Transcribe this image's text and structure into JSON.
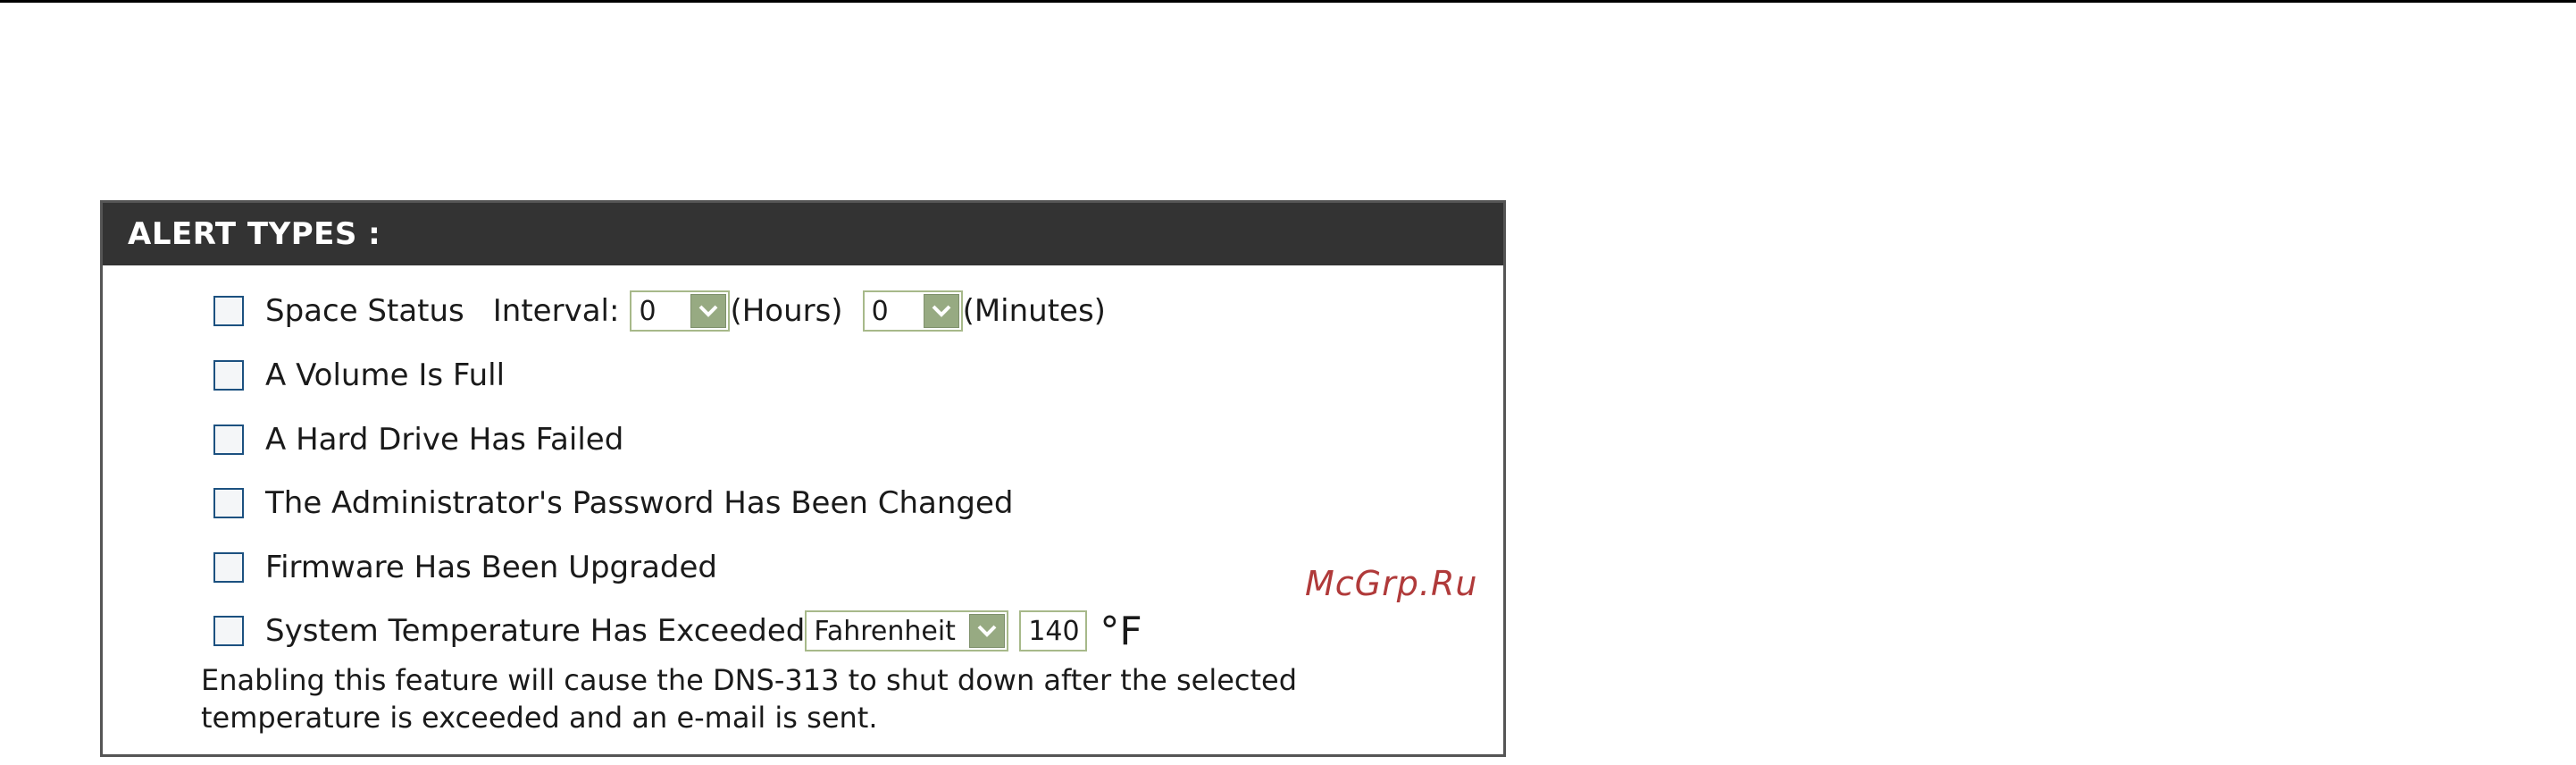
{
  "header": {
    "title": "ALERT TYPES :"
  },
  "alerts": {
    "space_status": {
      "label": "Space Status",
      "interval_label": "Interval:",
      "hours_value": "0",
      "hours_unit": "(Hours)",
      "minutes_value": "0",
      "minutes_unit": "(Minutes)",
      "checked": false
    },
    "volume_full": {
      "label": "A Volume Is Full",
      "checked": false
    },
    "drive_failed": {
      "label": "A Hard Drive Has Failed",
      "checked": false
    },
    "password_changed": {
      "label": "The Administrator's Password Has Been Changed",
      "checked": false
    },
    "firmware_upgraded": {
      "label": "Firmware Has Been Upgraded",
      "checked": false
    },
    "temperature": {
      "label": "System Temperature Has Exceeded",
      "scale_value": "Fahrenheit",
      "threshold_value": "140",
      "unit": "°F",
      "checked": false
    }
  },
  "note": {
    "line1": "Enabling this feature will cause the DNS-313 to shut down after the selected",
    "line2": "temperature is exceeded and an e-mail is sent."
  },
  "watermark": "McGrp.Ru",
  "colors": {
    "header_bg": "#333333",
    "checkbox_border": "#1c5180",
    "select_border": "#a7b98a",
    "select_button": "#97aa82"
  },
  "icons": {
    "dropdown": "chevron-down-icon"
  }
}
